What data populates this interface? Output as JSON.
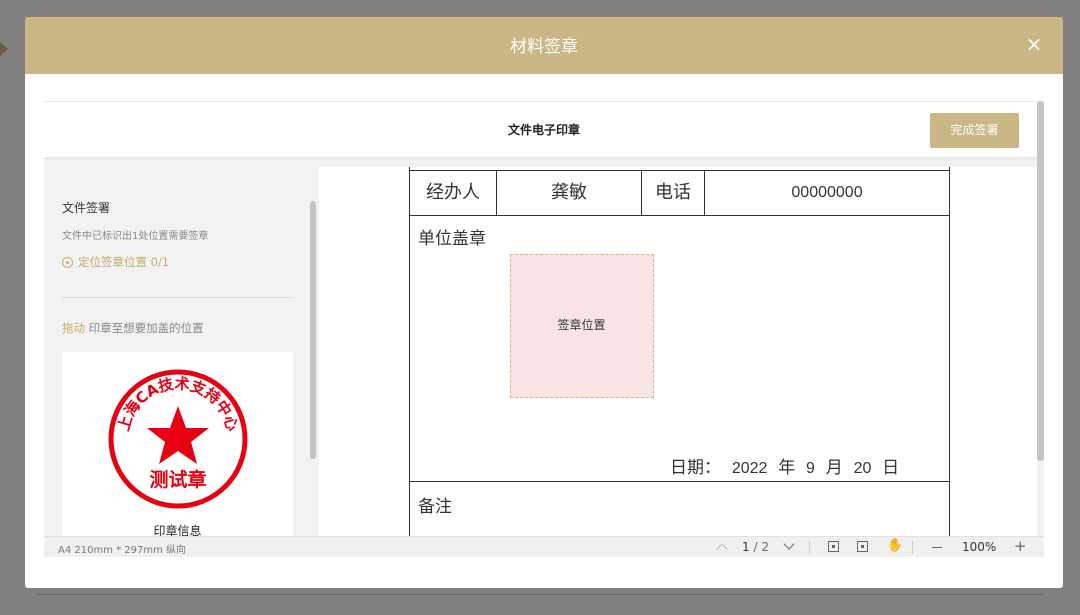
{
  "modal": {
    "title": "材料签章",
    "close_icon": "×"
  },
  "toolbar": {
    "title": "文件电子印章",
    "finish_label": "完成签署"
  },
  "left_panel": {
    "title": "文件签署",
    "description": "文件中已标识出1处位置需要签章",
    "locate_label": "定位签章位置 0/1",
    "drag_highlight": "拖动",
    "drag_text": " 印章至想要加盖的位置",
    "seal": {
      "ring_text": "上海CA技术支持中心",
      "center_text": "测试章",
      "color": "#e60012"
    },
    "seal_info_label": "印章信息"
  },
  "document": {
    "row": {
      "handler_label": "经办人",
      "handler_value": "龚敏",
      "phone_label": "电话",
      "phone_value": "00000000"
    },
    "unit_seal_label": "单位盖章",
    "sign_position_label": "签章位置",
    "date": {
      "label": "日期：",
      "year": "2022",
      "year_unit": "年",
      "month": "9",
      "month_unit": "月",
      "day": "20",
      "day_unit": "日"
    },
    "remarks_label": "备注"
  },
  "status_bar": {
    "paper_size": "A4 210mm * 297mm 纵向",
    "current_page": "1",
    "total_pages": "/ 2",
    "zoom": "100%",
    "plus": "+"
  }
}
